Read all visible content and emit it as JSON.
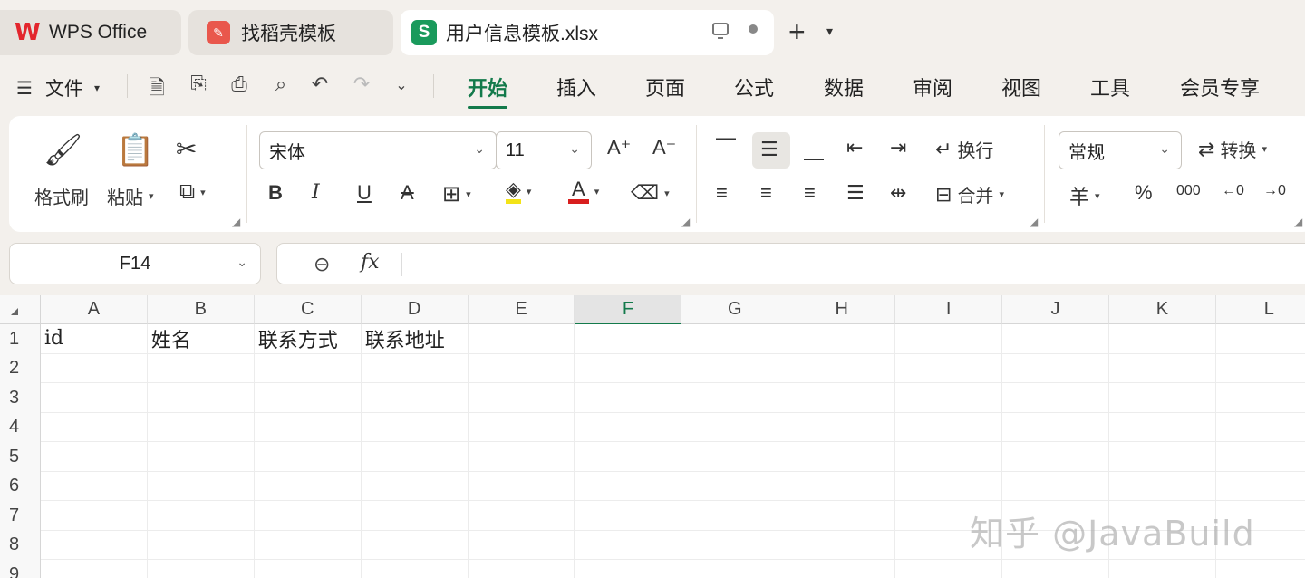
{
  "tabs": [
    {
      "label": "WPS Office",
      "icon": "wps-logo-icon"
    },
    {
      "label": "找稻壳模板",
      "icon": "daoke-logo-icon"
    },
    {
      "label": "用户信息模板.xlsx",
      "icon": "spreadsheet-s-icon",
      "active": true
    }
  ],
  "menu": {
    "file_label": "文件",
    "ribbon_tabs": [
      "开始",
      "插入",
      "页面",
      "公式",
      "数据",
      "审阅",
      "视图",
      "工具",
      "会员专享"
    ],
    "active_tab": "开始"
  },
  "ribbon": {
    "format_painter": "格式刷",
    "paste": "粘贴",
    "font_name": "宋体",
    "font_size": "11",
    "wrap_text": "换行",
    "merge": "合并",
    "number_format": "常规",
    "convert": "转换",
    "percent": "%",
    "thousands": "000",
    "currency": "羊"
  },
  "formula_bar": {
    "name_box": "F14",
    "fx": "fx",
    "value": ""
  },
  "sheet": {
    "columns": [
      "A",
      "B",
      "C",
      "D",
      "E",
      "F",
      "G",
      "H",
      "I",
      "J",
      "K",
      "L"
    ],
    "selected_column": "F",
    "rows": [
      "1",
      "2",
      "3",
      "4",
      "5",
      "6",
      "7",
      "8",
      "9"
    ],
    "row1": [
      "id",
      "姓名",
      "联系方式",
      "联系地址"
    ]
  },
  "watermark": "知乎 @JavaBuild",
  "colors": {
    "accent": "#137a4b",
    "wps_red": "#e3262d",
    "sheet_green": "#1a9a5c"
  }
}
